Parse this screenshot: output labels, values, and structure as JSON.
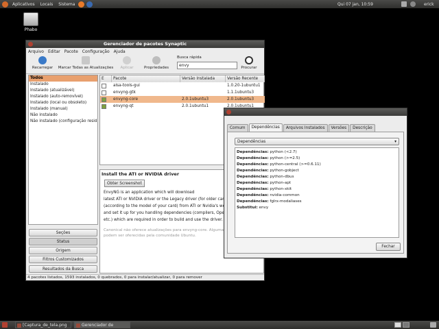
{
  "top_panel": {
    "menus": [
      "Aplicativos",
      "Locais",
      "Sistema"
    ],
    "clock": "Qui 07 jan, 10:59",
    "user": "erick"
  },
  "desktop": {
    "icon_label": "Phabo"
  },
  "main_window": {
    "title": "Gerenciador de pacotes Synaptic",
    "menu": [
      "Arquivo",
      "Editar",
      "Pacote",
      "Configuração",
      "Ajuda"
    ],
    "toolbar": {
      "reload": "Recarregar",
      "mark_all": "Marcar Todas as Atualizações",
      "apply": "Aplicar",
      "properties": "Propriedades",
      "search": "Procurar",
      "quick_search_label": "Busca rápida",
      "quick_search_value": "envy"
    },
    "filters": [
      "Todos",
      "Instalado",
      "Instalado (atualizável)",
      "Instalado (auto-removível)",
      "Instalado (local ou obsoleto)",
      "Instalado (manual)",
      "Não instalado",
      "Não instalado (configuração residu"
    ],
    "left_buttons": [
      "Seções",
      "Status",
      "Origem",
      "Filtros Customizados",
      "Resultados da Busca"
    ],
    "columns": {
      "s": "E",
      "package": "Pacote",
      "installed": "Versão Instalada",
      "latest": "Versão Recente"
    },
    "packages": [
      {
        "name": "alsa-tools-gui",
        "installed": "",
        "latest": "1.0.20-1ubuntu1"
      },
      {
        "name": "envyng-gtk",
        "installed": "",
        "latest": "1.1.1ubuntu3"
      },
      {
        "name": "envyng-core",
        "installed": "2.0.1ubuntu3",
        "latest": "2.0.1ubuntu3"
      },
      {
        "name": "envyng-qt",
        "installed": "2.0.1ubuntu1",
        "latest": "2.0.1ubuntu1"
      }
    ],
    "description": {
      "title": "Install the ATI or NVIDIA driver",
      "screenshot_button": "Obter Screenshot",
      "lines": [
        "EnvyNG is an application which will download",
        "latest ATI or NVIDIA driver or the Legacy driver (for older cards)",
        "(according to the model of your card) from ATI or Nvidia's websi",
        "and set it up for you handling dependencies (compilers, OpenGL",
        "etc.) which are required in order to build and use the driver."
      ],
      "note_lines": [
        "Canonical não oferece atualizações para envyng-core. Algumas",
        "podem ser oferecidas pela comunidade Ubuntu."
      ]
    },
    "status_bar": "4 pacotes listados, 1593 instalados, 0 quebrados, 0 para instalar/atualizar, 0 para remover"
  },
  "dialog": {
    "tabs": [
      "Comum",
      "Dependências",
      "Arquivos Instalados",
      "Versões",
      "Descrição"
    ],
    "select_value": "Dependências",
    "deps": [
      {
        "k": "Dependências:",
        "v": "python (<2.7)"
      },
      {
        "k": "Dependências:",
        "v": "python (>=2.5)"
      },
      {
        "k": "Dependências:",
        "v": "python-central (>=0.6.11)"
      },
      {
        "k": "Dependências:",
        "v": "python-gobject"
      },
      {
        "k": "Dependências:",
        "v": "python-dbus"
      },
      {
        "k": "Dependências:",
        "v": "python-apt"
      },
      {
        "k": "Dependências:",
        "v": "python-xkit"
      },
      {
        "k": "Dependências:",
        "v": "nvidia-common"
      },
      {
        "k": "Dependências:",
        "v": "fglrx-modaliases"
      },
      {
        "k": "Substitui:",
        "v": "envy"
      }
    ],
    "close": "Fechar"
  },
  "bottom_panel": {
    "tasks": [
      "[Captura_de_tela.png ...",
      "Gerenciador de pacotes ..."
    ]
  }
}
